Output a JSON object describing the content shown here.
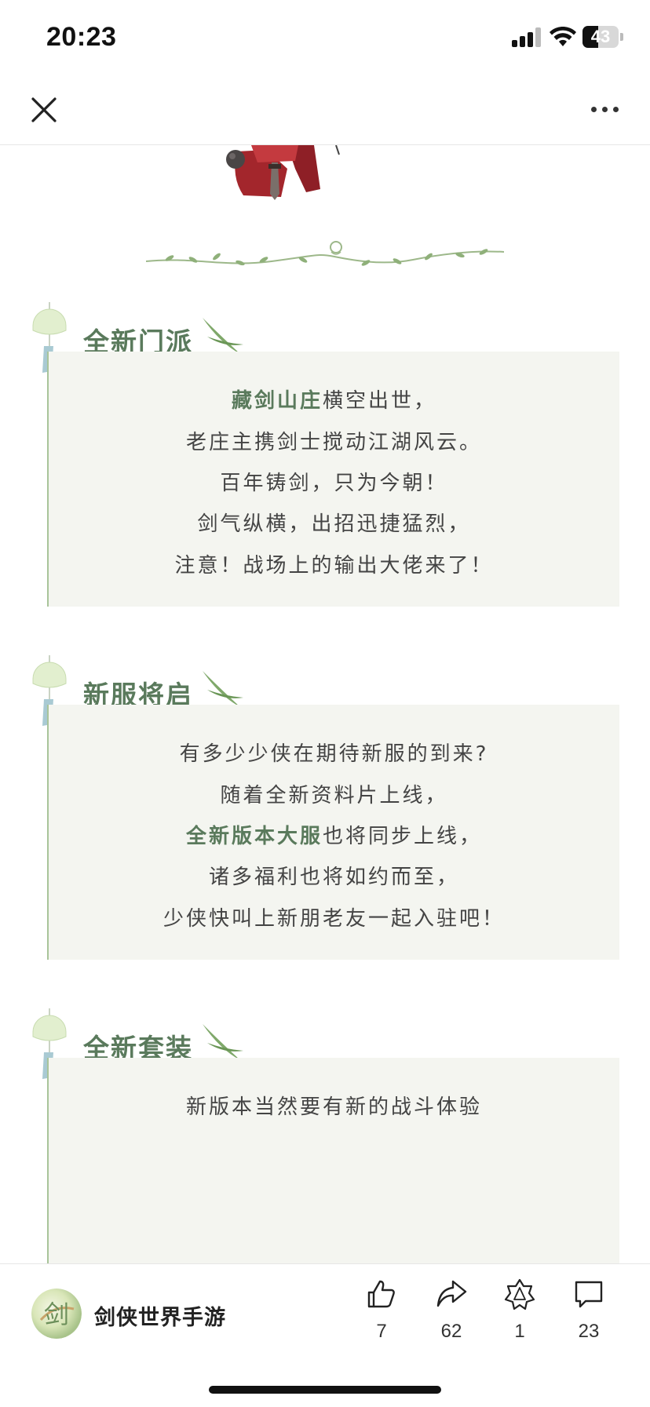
{
  "status_bar": {
    "time": "20:23",
    "battery_level": "43",
    "battery_fraction": 0.43
  },
  "nav": {
    "close_icon": "close-icon",
    "more_icon": "more-icon"
  },
  "sections": [
    {
      "title": "全新门派",
      "lines": [
        {
          "highlight": "藏剑山庄",
          "text": "横空出世，"
        },
        {
          "highlight": "",
          "text": "老庄主携剑士搅动江湖风云。"
        },
        {
          "highlight": "",
          "text": "百年铸剑，只为今朝！"
        },
        {
          "highlight": "",
          "text": "剑气纵横，出招迅捷猛烈，"
        },
        {
          "highlight": "",
          "text": "注意！战场上的输出大佬来了！"
        }
      ]
    },
    {
      "title": "新服将启",
      "lines": [
        {
          "highlight": "",
          "text": "有多少少侠在期待新服的到来?"
        },
        {
          "highlight": "",
          "text": "随着全新资料片上线，"
        },
        {
          "highlight": "全新版本大服",
          "text": "也将同步上线，"
        },
        {
          "highlight": "",
          "text": "诸多福利也将如约而至，"
        },
        {
          "highlight": "",
          "text": "少侠快叫上新朋老友一起入驻吧！"
        }
      ]
    },
    {
      "title": "全新套装",
      "lines": [
        {
          "highlight": "",
          "text": "新版本当然要有新的战斗体验"
        }
      ]
    }
  ],
  "toolbar": {
    "account_name": "剑侠世界手游",
    "avatar_glyph": "剑",
    "actions": [
      {
        "icon": "thumbs-up-icon",
        "count": "7"
      },
      {
        "icon": "share-icon",
        "count": "62"
      },
      {
        "icon": "wow-star-icon",
        "count": "1"
      },
      {
        "icon": "comment-icon",
        "count": "23"
      }
    ]
  },
  "colors": {
    "accent_green": "#5a7a5c",
    "card_bg": "#f4f5f0",
    "card_border": "#a9c49a"
  }
}
